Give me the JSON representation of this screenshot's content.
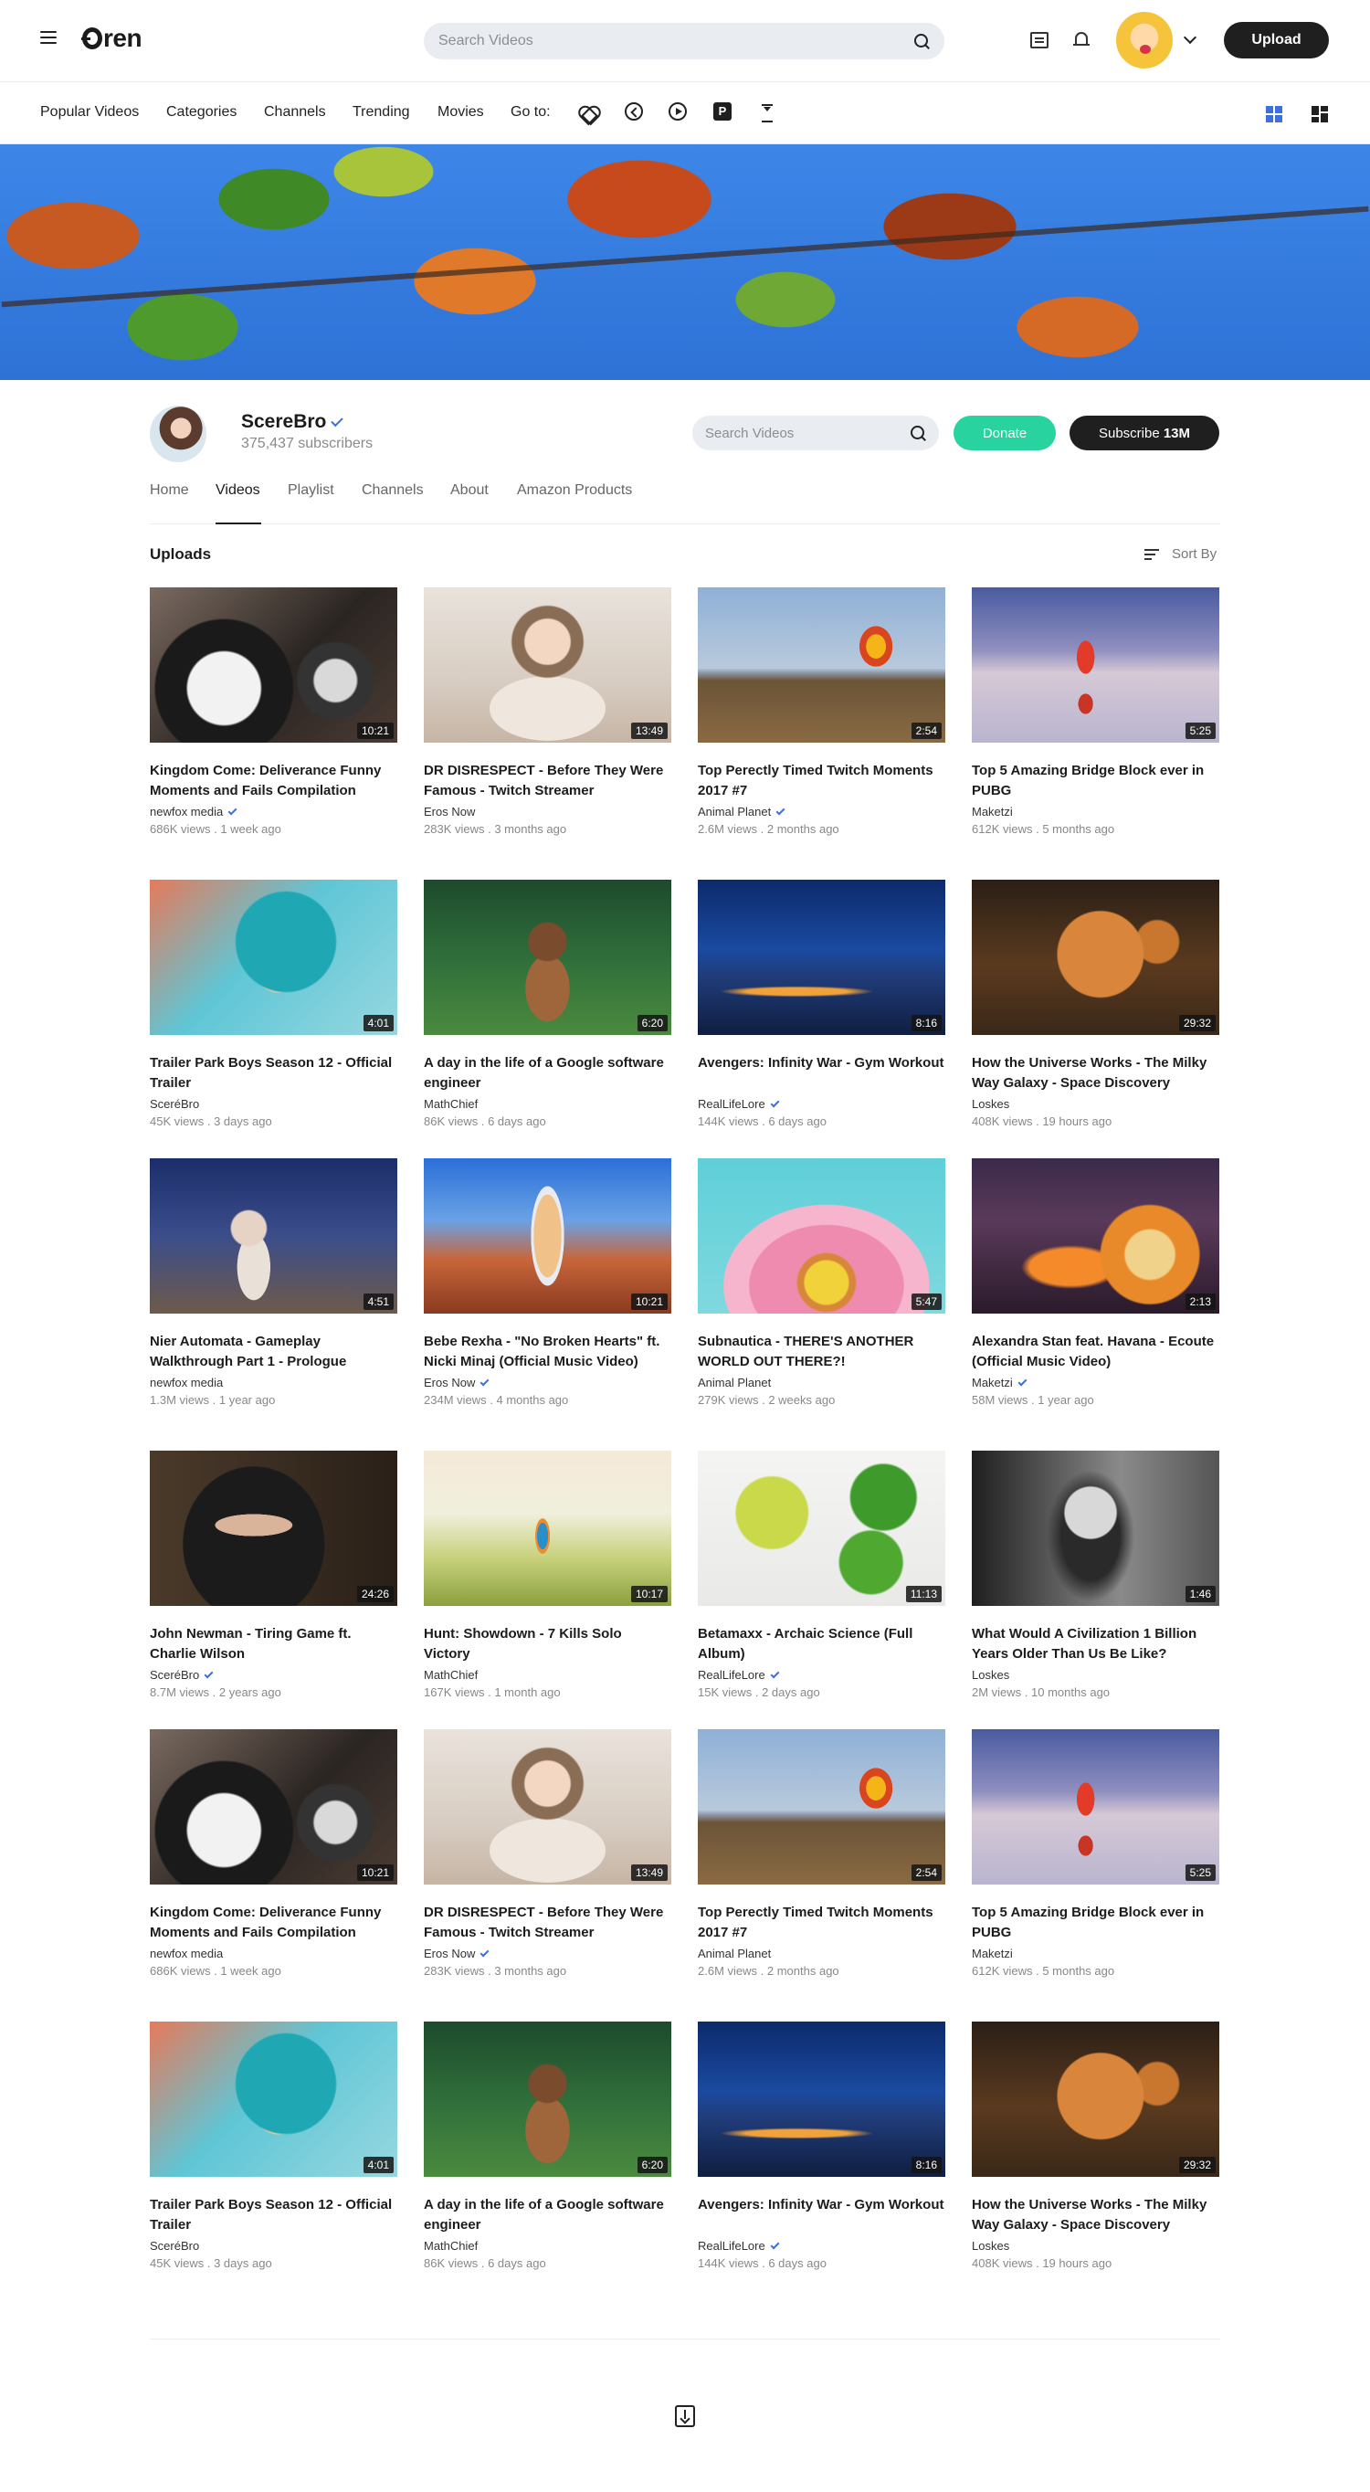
{
  "header": {
    "logo": "Oren",
    "search_placeholder": "Search Videos",
    "upload_label": "Upload"
  },
  "nav": {
    "items": [
      "Popular Videos",
      "Categories",
      "Channels",
      "Trending",
      "Movies",
      "Go to:"
    ],
    "goto_icons": [
      "heart-icon",
      "history-icon",
      "play-icon",
      "p-icon",
      "hourglass-icon"
    ],
    "p_letter": "P"
  },
  "channel": {
    "name": "ScereBro",
    "subscribers": "375,437 subscribers",
    "search_placeholder": "Search Videos",
    "donate_label": "Donate",
    "subscribe_label": "Subscribe",
    "subscribe_count": "13M",
    "tabs": [
      "Home",
      "Videos",
      "Playlist",
      "Channels",
      "About",
      "Amazon Products"
    ],
    "active_tab": "Videos"
  },
  "section": {
    "title": "Uploads",
    "sort_label": "Sort By"
  },
  "colors": {
    "accent_blue": "#3d6fe0",
    "donate_green": "#29d3a0",
    "dark": "#1f1f1f"
  },
  "videos": [
    {
      "title": "Kingdom Come: Deliverance Funny Moments and Fails Compilation",
      "channel": "newfox media",
      "verified": true,
      "views": "686K views",
      "age": "1 week ago",
      "duration": "10:21",
      "thumb": "car"
    },
    {
      "title": "DR DISRESPECT - Before They Were Famous - Twitch Streamer",
      "channel": "Eros Now",
      "verified": false,
      "views": "283K views",
      "age": "3 months ago",
      "duration": "13:49",
      "thumb": "baby"
    },
    {
      "title": "Top Perectly Timed Twitch Moments 2017 #7",
      "channel": "Animal Planet",
      "verified": true,
      "views": "2.6M views",
      "age": "2 months ago",
      "duration": "2:54",
      "thumb": "balloon"
    },
    {
      "title": "Top 5 Amazing Bridge Block ever in PUBG",
      "channel": "Maketzi",
      "verified": false,
      "views": "612K views",
      "age": "5 months ago",
      "duration": "5:25",
      "thumb": "dancer"
    },
    {
      "title": "Trailer Park Boys Season 12 - Official Trailer",
      "channel": "SceréBro",
      "verified": false,
      "views": "45K views",
      "age": "3 days ago",
      "duration": "4:01",
      "thumb": "bluehair"
    },
    {
      "title": "A day in the life of a Google software engineer",
      "channel": "MathChief",
      "verified": false,
      "views": "86K views",
      "age": "6 days ago",
      "duration": "6:20",
      "thumb": "boy"
    },
    {
      "title": "Avengers: Infinity War - Gym Workout",
      "channel": "RealLifeLore",
      "verified": true,
      "views": "144K views",
      "age": "6 days ago",
      "duration": "8:16",
      "thumb": "bridge"
    },
    {
      "title": "How the Universe Works - The Milky Way Galaxy - Space Discovery",
      "channel": "Loskes",
      "verified": false,
      "views": "408K views",
      "age": "19 hours ago",
      "duration": "29:32",
      "thumb": "cat"
    },
    {
      "title": "Nier Automata - Gameplay Walkthrough Part 1 - Prologue",
      "channel": "newfox media",
      "verified": false,
      "views": "1.3M views",
      "age": "1 year ago",
      "duration": "4:51",
      "thumb": "winter"
    },
    {
      "title": "Bebe Rexha - \"No Broken Hearts\" ft. Nicki Minaj (Official Music Video)",
      "channel": "Eros Now",
      "verified": true,
      "views": "234M views",
      "age": "4 months ago",
      "duration": "10:21",
      "thumb": "woman"
    },
    {
      "title": "Subnautica - THERE'S ANOTHER WORLD OUT THERE?!",
      "channel": "Animal Planet",
      "verified": false,
      "views": "279K views",
      "age": "2 weeks ago",
      "duration": "5:47",
      "thumb": "flower"
    },
    {
      "title": "Alexandra Stan feat. Havana - Ecoute (Official Music Video)",
      "channel": "Maketzi",
      "verified": true,
      "views": "58M views",
      "age": "1 year ago",
      "duration": "2:13",
      "thumb": "soccer"
    },
    {
      "title": "John Newman - Tiring Game ft. Charlie Wilson",
      "channel": "SceréBro",
      "verified": true,
      "views": "8.7M views",
      "age": "2 years ago",
      "duration": "24:26",
      "thumb": "hijab"
    },
    {
      "title": "Hunt: Showdown - 7 Kills Solo Victory",
      "channel": "MathChief",
      "verified": false,
      "views": "167K views",
      "age": "1 month ago",
      "duration": "10:17",
      "thumb": "bird"
    },
    {
      "title": "Betamaxx - Archaic Science (Full Album)",
      "channel": "RealLifeLore",
      "verified": true,
      "views": "15K views",
      "age": "2 days ago",
      "duration": "11:13",
      "thumb": "mint"
    },
    {
      "title": "What Would A Civilization 1 Billion Years Older Than Us Be Like?",
      "channel": "Loskes",
      "verified": false,
      "views": "2M views",
      "age": "10 months ago",
      "duration": "1:46",
      "thumb": "bw"
    },
    {
      "title": "Kingdom Come: Deliverance Funny Moments and Fails Compilation",
      "channel": "newfox media",
      "verified": false,
      "views": "686K views",
      "age": "1 week ago",
      "duration": "10:21",
      "thumb": "car"
    },
    {
      "title": "DR DISRESPECT - Before They Were Famous - Twitch Streamer",
      "channel": "Eros Now",
      "verified": true,
      "views": "283K views",
      "age": "3 months ago",
      "duration": "13:49",
      "thumb": "baby"
    },
    {
      "title": "Top Perectly Timed Twitch Moments 2017 #7",
      "channel": "Animal Planet",
      "verified": false,
      "views": "2.6M views",
      "age": "2 months ago",
      "duration": "2:54",
      "thumb": "balloon"
    },
    {
      "title": "Top 5 Amazing Bridge Block ever in PUBG",
      "channel": "Maketzi",
      "verified": false,
      "views": "612K views",
      "age": "5 months ago",
      "duration": "5:25",
      "thumb": "dancer"
    },
    {
      "title": "Trailer Park Boys Season 12 - Official Trailer",
      "channel": "SceréBro",
      "verified": false,
      "views": "45K views",
      "age": "3 days ago",
      "duration": "4:01",
      "thumb": "bluehair"
    },
    {
      "title": "A day in the life of a Google software engineer",
      "channel": "MathChief",
      "verified": false,
      "views": "86K views",
      "age": "6 days ago",
      "duration": "6:20",
      "thumb": "boy"
    },
    {
      "title": "Avengers: Infinity War - Gym Workout",
      "channel": "RealLifeLore",
      "verified": true,
      "views": "144K views",
      "age": "6 days ago",
      "duration": "8:16",
      "thumb": "bridge"
    },
    {
      "title": "How the Universe Works - The Milky Way Galaxy - Space Discovery",
      "channel": "Loskes",
      "verified": false,
      "views": "408K views",
      "age": "19 hours ago",
      "duration": "29:32",
      "thumb": "cat"
    }
  ]
}
